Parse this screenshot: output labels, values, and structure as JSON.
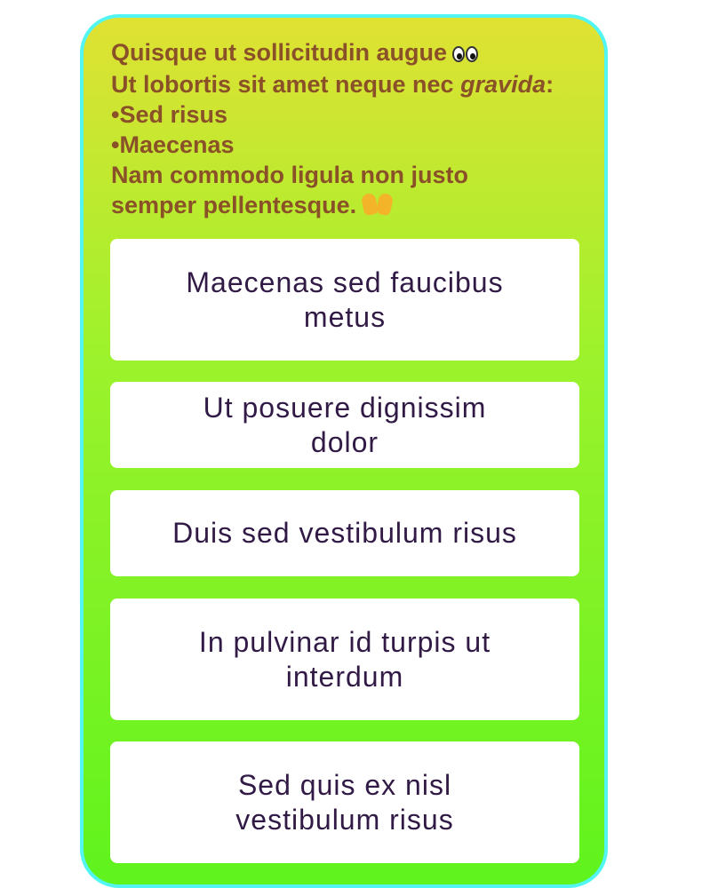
{
  "prompt": {
    "line1": "Quisque ut sollicitudin augue",
    "line1_emoji": "eyes-emoji",
    "line2_prefix": "Ut lobortis sit amet neque nec ",
    "line2_italic": "gravida",
    "line2_suffix": ":",
    "bullet1": "•Sed risus",
    "bullet2": "•Maecenas",
    "line5": "Nam commodo ligula non justo",
    "line6": "semper pellentesque.",
    "line6_emoji": "raising-hands-emoji"
  },
  "options": [
    {
      "label": "Maecenas sed faucibus metus"
    },
    {
      "label": "Ut posuere dignissim dolor"
    },
    {
      "label": "Duis sed vestibulum risus"
    },
    {
      "label": "In pulvinar id turpis ut interdum"
    },
    {
      "label": "Sed quis ex nisl vestibulum risus"
    }
  ],
  "colors": {
    "card_border": "#52f5f2",
    "gradient_top": "#e0e133",
    "gradient_bottom": "#5ff31d",
    "prompt_text": "#8a5129",
    "option_text": "#311a45",
    "option_bg": "#ffffff"
  }
}
